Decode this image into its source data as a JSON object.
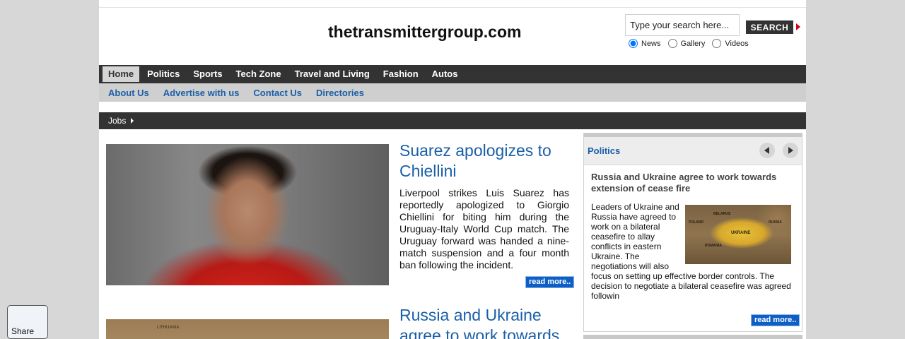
{
  "site": {
    "title": "thetransmittergroup.com"
  },
  "search": {
    "placeholder": "Type your search here...",
    "button_label": "SEARCH",
    "options": [
      {
        "label": "News",
        "selected": true
      },
      {
        "label": "Gallery",
        "selected": false
      },
      {
        "label": "Videos",
        "selected": false
      }
    ]
  },
  "main_nav": [
    "Home",
    "Politics",
    "Sports",
    "Tech Zone",
    "Travel and Living",
    "Fashion",
    "Autos"
  ],
  "main_nav_active": "Home",
  "sub_nav": [
    "About Us",
    "Advertise with us",
    "Contact Us",
    "Directories"
  ],
  "jobs_nav": {
    "label": "Jobs"
  },
  "articles": [
    {
      "title": "Suarez apologizes to Chiellini",
      "body": "Liverpool strikes Luis Suarez has reportedly apologized to Giorgio Chiellini for biting him during the Uruguay-Italy World Cup match. The Uruguay forward was handed a nine-match suspension and a four month ban following the incident.",
      "read_more": "read more.."
    },
    {
      "title": "Russia and Ukraine agree to work towards",
      "image_label": "LITHUANIA"
    }
  ],
  "sidebar": {
    "section": "Politics",
    "article_title": "Russia and Ukraine agree to work towards extension of cease fire",
    "body_wrap": "Leaders of Ukraine and Russia have agreed to work on a bilateral ceasefire to allay conflicts in eastern Ukraine. The negotiations will also",
    "body_full": "focus on setting up effective border controls. The decision to negotiate a bilateral ceasefire was agreed followin",
    "read_more": "read more..",
    "map_labels": {
      "l1": "BELARUS",
      "l2": "POLAND",
      "l3": "UKRAINE",
      "l4": "RUSSIA",
      "l5": "ROMANIA"
    }
  },
  "share": {
    "label": "Share"
  }
}
